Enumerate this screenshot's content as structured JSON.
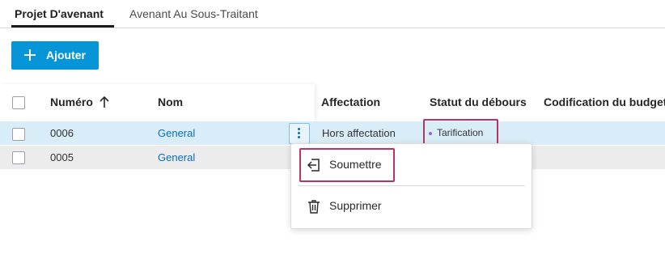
{
  "tabs": [
    {
      "label": "Projet D'avenant",
      "active": true
    },
    {
      "label": "Avenant Au Sous-Traitant",
      "active": false
    }
  ],
  "toolbar": {
    "add_label": "Ajouter"
  },
  "table": {
    "columns": [
      "Numéro",
      "Nom",
      "Affectation",
      "Statut du débours",
      "Codification du budget"
    ],
    "sorted_column": "Numéro",
    "rows": [
      {
        "numero": "0006",
        "nom": "General",
        "affectation": "Hors affectation",
        "statut": "Tarification"
      },
      {
        "numero": "0005",
        "nom": "General",
        "affectation": "",
        "statut": ""
      }
    ]
  },
  "context_menu": {
    "items": [
      {
        "label": "Soumettre",
        "icon": "submit-icon"
      },
      {
        "label": "Supprimer",
        "icon": "trash-icon"
      }
    ]
  },
  "colors": {
    "accent": "#0696d7",
    "link": "#0a6fbd",
    "selected_row": "#d8edf8",
    "highlight": "#b8336a",
    "status_dot": "#8e6ad8"
  }
}
